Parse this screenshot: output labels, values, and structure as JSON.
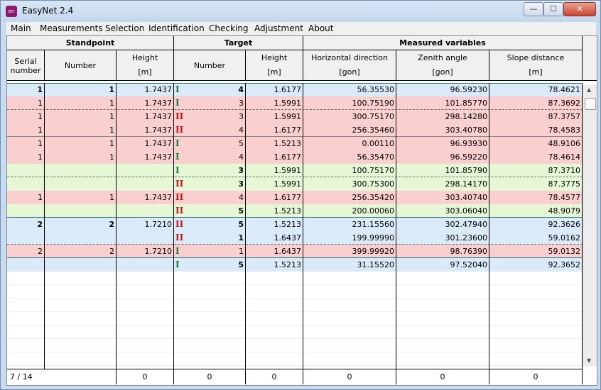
{
  "window": {
    "title": "EasyNet 2.4",
    "app_icon_text": "en"
  },
  "menu": [
    "Main",
    "Measurements",
    "Selection",
    "Identification",
    "Checking",
    "Adjustment",
    "About"
  ],
  "header": {
    "group_standpoint": "Standpoint",
    "group_target": "Target",
    "group_measured": "Measured variables",
    "serial_number": "Serial number",
    "number": "Number",
    "height": "Height",
    "unit_m": "[m]",
    "target_number": "Number",
    "target_height": "Height",
    "horizontal_direction": "Horizontal direction",
    "zenith_angle": "Zenith angle",
    "slope_distance": "Slope distance",
    "unit_gon": "[gon]"
  },
  "colors": {
    "blue": "#daeaf8",
    "red": "#f9cfcf",
    "green": "#e6f7d6",
    "white": "#ffffff"
  },
  "rows": [
    {
      "bg": "blue",
      "serial": "1",
      "number": "1",
      "height": "1.7437",
      "face": "I",
      "tnum": "4",
      "theight": "1.6177",
      "hd": "56.35530",
      "za": "96.59230",
      "sd": "78.4621",
      "bold": true,
      "tbold": true
    },
    {
      "bg": "red",
      "serial": "1",
      "number": "1",
      "height": "1.7437",
      "face": "I",
      "tnum": "3",
      "theight": "1.5991",
      "hd": "100.75190",
      "za": "101.85770",
      "sd": "87.3692"
    },
    {
      "bg": "red",
      "serial": "1",
      "number": "1",
      "height": "1.7437",
      "face": "II",
      "tnum": "3",
      "theight": "1.5991",
      "hd": "300.75170",
      "za": "298.14280",
      "sd": "87.3757"
    },
    {
      "bg": "red",
      "serial": "1",
      "number": "1",
      "height": "1.7437",
      "face": "II",
      "tnum": "4",
      "theight": "1.6177",
      "hd": "256.35460",
      "za": "303.40780",
      "sd": "78.4583"
    },
    {
      "bg": "red",
      "serial": "1",
      "number": "1",
      "height": "1.7437",
      "face": "I",
      "tnum": "5",
      "theight": "1.5213",
      "hd": "0.00110",
      "za": "96.93930",
      "sd": "48.9106"
    },
    {
      "bg": "red",
      "serial": "1",
      "number": "1",
      "height": "1.7437",
      "face": "I",
      "tnum": "4",
      "theight": "1.6177",
      "hd": "56.35470",
      "za": "96.59220",
      "sd": "78.4614"
    },
    {
      "bg": "green",
      "serial": "",
      "number": "",
      "height": "",
      "face": "I",
      "tnum": "3",
      "theight": "1.5991",
      "hd": "100.75170",
      "za": "101.85790",
      "sd": "87.3710",
      "tbold": true
    },
    {
      "bg": "green",
      "serial": "",
      "number": "",
      "height": "",
      "face": "II",
      "tnum": "3",
      "theight": "1.5991",
      "hd": "300.75300",
      "za": "298.14170",
      "sd": "87.3775",
      "tbold": true
    },
    {
      "bg": "red",
      "serial": "1",
      "number": "1",
      "height": "1.7437",
      "face": "II",
      "tnum": "4",
      "theight": "1.6177",
      "hd": "256.35420",
      "za": "303.40740",
      "sd": "78.4577"
    },
    {
      "bg": "green",
      "serial": "",
      "number": "",
      "height": "",
      "face": "II",
      "tnum": "5",
      "theight": "1.5213",
      "hd": "200.00060",
      "za": "303.06040",
      "sd": "48.9079",
      "tbold": true
    },
    {
      "bg": "blue",
      "serial": "2",
      "number": "2",
      "height": "1.7210",
      "face": "II",
      "tnum": "5",
      "theight": "1.5213",
      "hd": "231.15560",
      "za": "302.47940",
      "sd": "92.3626",
      "bold": true,
      "tbold": true
    },
    {
      "bg": "blue",
      "serial": "",
      "number": "",
      "height": "",
      "face": "II",
      "tnum": "1",
      "theight": "1.6437",
      "hd": "199.99990",
      "za": "301.23600",
      "sd": "59.0162",
      "tbold": true
    },
    {
      "bg": "red",
      "serial": "2",
      "number": "2",
      "height": "1.7210",
      "face": "I",
      "tnum": "1",
      "theight": "1.6437",
      "hd": "399.99920",
      "za": "98.76390",
      "sd": "59.0132"
    },
    {
      "bg": "blue",
      "serial": "",
      "number": "",
      "height": "",
      "face": "I",
      "tnum": "5",
      "theight": "1.5213",
      "hd": "31.15520",
      "za": "97.52040",
      "sd": "92.3652",
      "tbold": true
    }
  ],
  "footer": {
    "position": "7 / 14",
    "c_height": "0",
    "c_tnum": "0",
    "c_theight": "0",
    "c_hd": "0",
    "c_za": "0",
    "c_sd": "0"
  },
  "window_buttons": {
    "minimize": "—",
    "maximize": "☐",
    "close": "✕"
  },
  "scroll": {
    "up": "▲",
    "down": "▼"
  }
}
